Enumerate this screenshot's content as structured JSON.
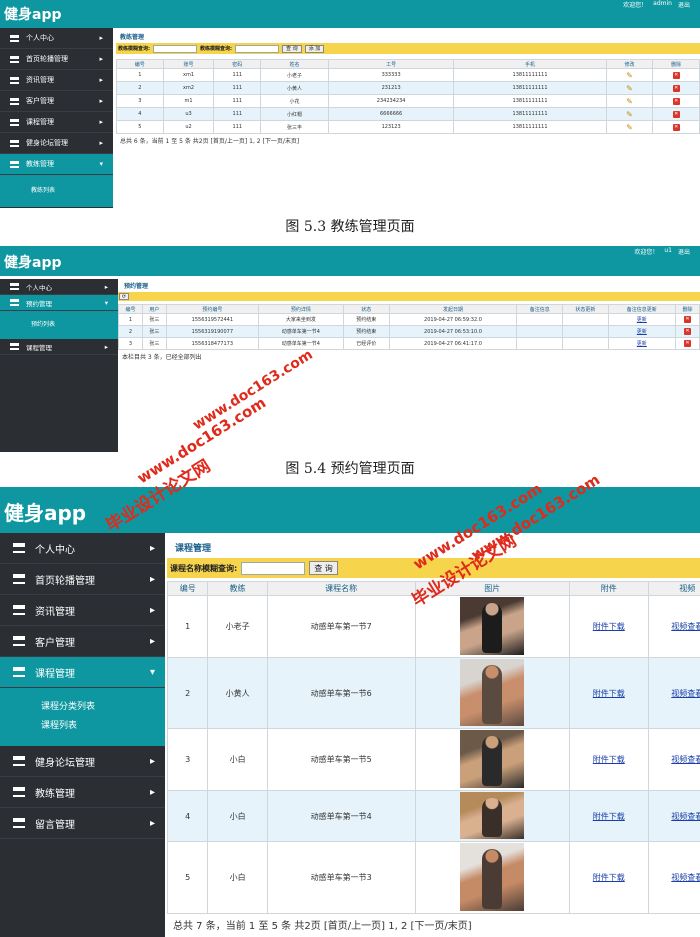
{
  "colors": {
    "teal": "#0e97a0",
    "sidebar": "#2b2e33",
    "yellow": "#f6d44c",
    "link": "#1a3fa8",
    "delete": "#d9352b"
  },
  "shot1": {
    "app_title": "健身app",
    "user": {
      "welcome": "欢迎您！",
      "name": "admin",
      "logout": "退出"
    },
    "menu": [
      "个人中心",
      "首页轮播管理",
      "资讯管理",
      "客户管理",
      "课程管理",
      "健身论坛管理",
      "教练管理"
    ],
    "submenu": [
      "教练列表"
    ],
    "menu_after": [
      "留言管理"
    ],
    "crumb": "教练管理",
    "search": {
      "label1": "教练模糊查询:",
      "label2": "教练模糊查询:",
      "btn_search": "查 询",
      "btn_add": "添 加"
    },
    "columns": [
      "编号",
      "账号",
      "密码",
      "姓名",
      "工号",
      "手机",
      "修改",
      "删除"
    ],
    "rows": [
      [
        "1",
        "xm1",
        "111",
        "小老子",
        "333333",
        "13811111111"
      ],
      [
        "2",
        "xm2",
        "111",
        "小黄人",
        "231213",
        "13811111111"
      ],
      [
        "3",
        "m1",
        "111",
        "小花",
        "234234234",
        "13811111111"
      ],
      [
        "4",
        "u3",
        "111",
        "小红帽",
        "6666666",
        "13811111111"
      ],
      [
        "5",
        "u2",
        "111",
        "张三丰",
        "123123",
        "13811111111"
      ]
    ],
    "footer": "总共 6 条，当前 1 至 5 条 共2页 [首页/上一页] 1, 2 [下一页/末页]"
  },
  "caption1": "图 5.3 教练管理页面",
  "shot2": {
    "app_title": "健身app",
    "user": {
      "welcome": "欢迎您！",
      "name": "u1",
      "logout": "退出"
    },
    "menu": [
      "个人中心",
      "预约管理"
    ],
    "submenu": [
      "预约列表"
    ],
    "menu_after": [
      "课程管理"
    ],
    "crumb": "预约管理",
    "columns": [
      "编号",
      "用户",
      "预约编号",
      "预约详情",
      "状态",
      "发起日期",
      "备注信息",
      "状态更新",
      "备注信息更新",
      "删除"
    ],
    "rows": [
      [
        "1",
        "张三",
        "1556319572441",
        "大家来坐到发",
        "预约结束",
        "2019-04-27 06:59:32.0",
        "",
        "",
        "更新"
      ],
      [
        "2",
        "张三",
        "1556319190077",
        "动感单车第一节4",
        "预约结束",
        "2019-04-27 06:53:10.0",
        "",
        "",
        "更新"
      ],
      [
        "3",
        "张三",
        "1556318477173",
        "动感单车第一节4",
        "已经评价",
        "2019-04-27 06:41:17.0",
        "",
        "",
        "更新"
      ]
    ],
    "footer": "本栏目共 3 条，已经全部列出"
  },
  "caption2": "图 5.4 预约管理页面",
  "shot3": {
    "app_title": "健身app",
    "menu": [
      "个人中心",
      "首页轮播管理",
      "资讯管理",
      "客户管理",
      "课程管理"
    ],
    "submenu": [
      "课程分类列表",
      "课程列表"
    ],
    "menu_after": [
      "健身论坛管理",
      "教练管理",
      "留言管理"
    ],
    "crumb": "课程管理",
    "search": {
      "label": "课程名称模糊查询:",
      "btn_search": "查 询"
    },
    "columns": [
      "编号",
      "教练",
      "课程名称",
      "图片",
      "附件",
      "视频"
    ],
    "rows": [
      [
        "1",
        "小老子",
        "动感单车第一节7",
        "附件下载",
        "视频查看"
      ],
      [
        "2",
        "小黄人",
        "动感单车第一节6",
        "附件下载",
        "视频查看"
      ],
      [
        "3",
        "小白",
        "动感单车第一节5",
        "附件下载",
        "视频查看"
      ],
      [
        "4",
        "小白",
        "动感单车第一节4",
        "附件下载",
        "视频查看"
      ],
      [
        "5",
        "小白",
        "动感单车第一节3",
        "附件下载",
        "视频查看"
      ]
    ],
    "footer": "总共 7 条，当前 1 至 5 条 共2页 [首页/上一页] 1, 2 [下一页/末页]"
  },
  "watermarks": [
    "毕业设计论文网",
    "www.doc163.com"
  ]
}
